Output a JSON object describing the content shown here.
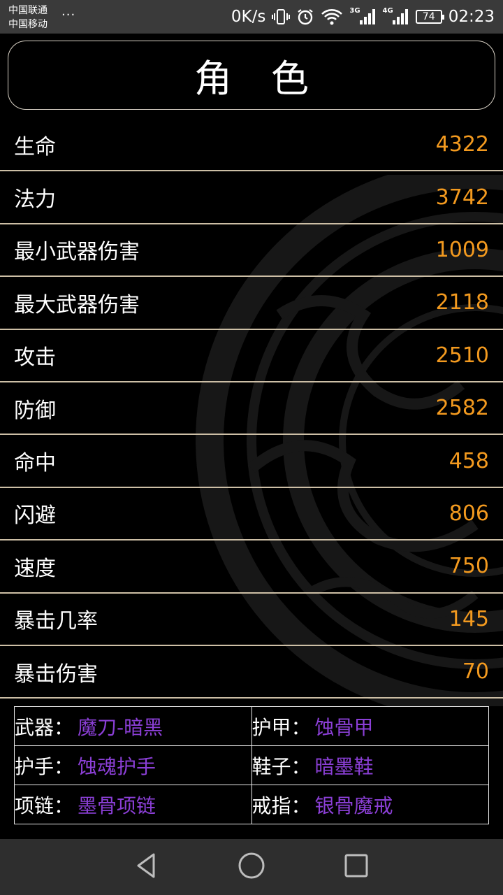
{
  "status_bar": {
    "carrier1": "中国联通",
    "carrier2": "中国移动",
    "dots": "...",
    "speed": "0K/s",
    "net1": "3G",
    "net2": "4G",
    "battery": "74",
    "time": "02:23"
  },
  "title": "角色",
  "stats": [
    {
      "label": "生命",
      "value": "4322"
    },
    {
      "label": "法力",
      "value": "3742"
    },
    {
      "label": "最小武器伤害",
      "value": "1009"
    },
    {
      "label": "最大武器伤害",
      "value": "2118"
    },
    {
      "label": "攻击",
      "value": "2510"
    },
    {
      "label": "防御",
      "value": "2582"
    },
    {
      "label": "命中",
      "value": "458"
    },
    {
      "label": "闪避",
      "value": "806"
    },
    {
      "label": "速度",
      "value": "750"
    },
    {
      "label": "暴击几率",
      "value": "145"
    },
    {
      "label": "暴击伤害",
      "value": "70"
    }
  ],
  "equipment": [
    {
      "slot": "武器：",
      "item": "魔刀-暗黑"
    },
    {
      "slot": "护甲：",
      "item": "蚀骨甲"
    },
    {
      "slot": "护手：",
      "item": "蚀魂护手"
    },
    {
      "slot": "鞋子：",
      "item": "暗墨鞋"
    },
    {
      "slot": "项链：",
      "item": "墨骨项链"
    },
    {
      "slot": "戒指：",
      "item": "银骨魔戒"
    }
  ],
  "colors": {
    "value": "#f39a1f",
    "equipment_item": "#8b3fd6",
    "divider": "#cdbfa6"
  },
  "icons": [
    "vibrate-icon",
    "alarm-icon",
    "wifi-icon",
    "signal-icon",
    "battery-icon",
    "back-icon",
    "home-icon",
    "recents-icon"
  ]
}
